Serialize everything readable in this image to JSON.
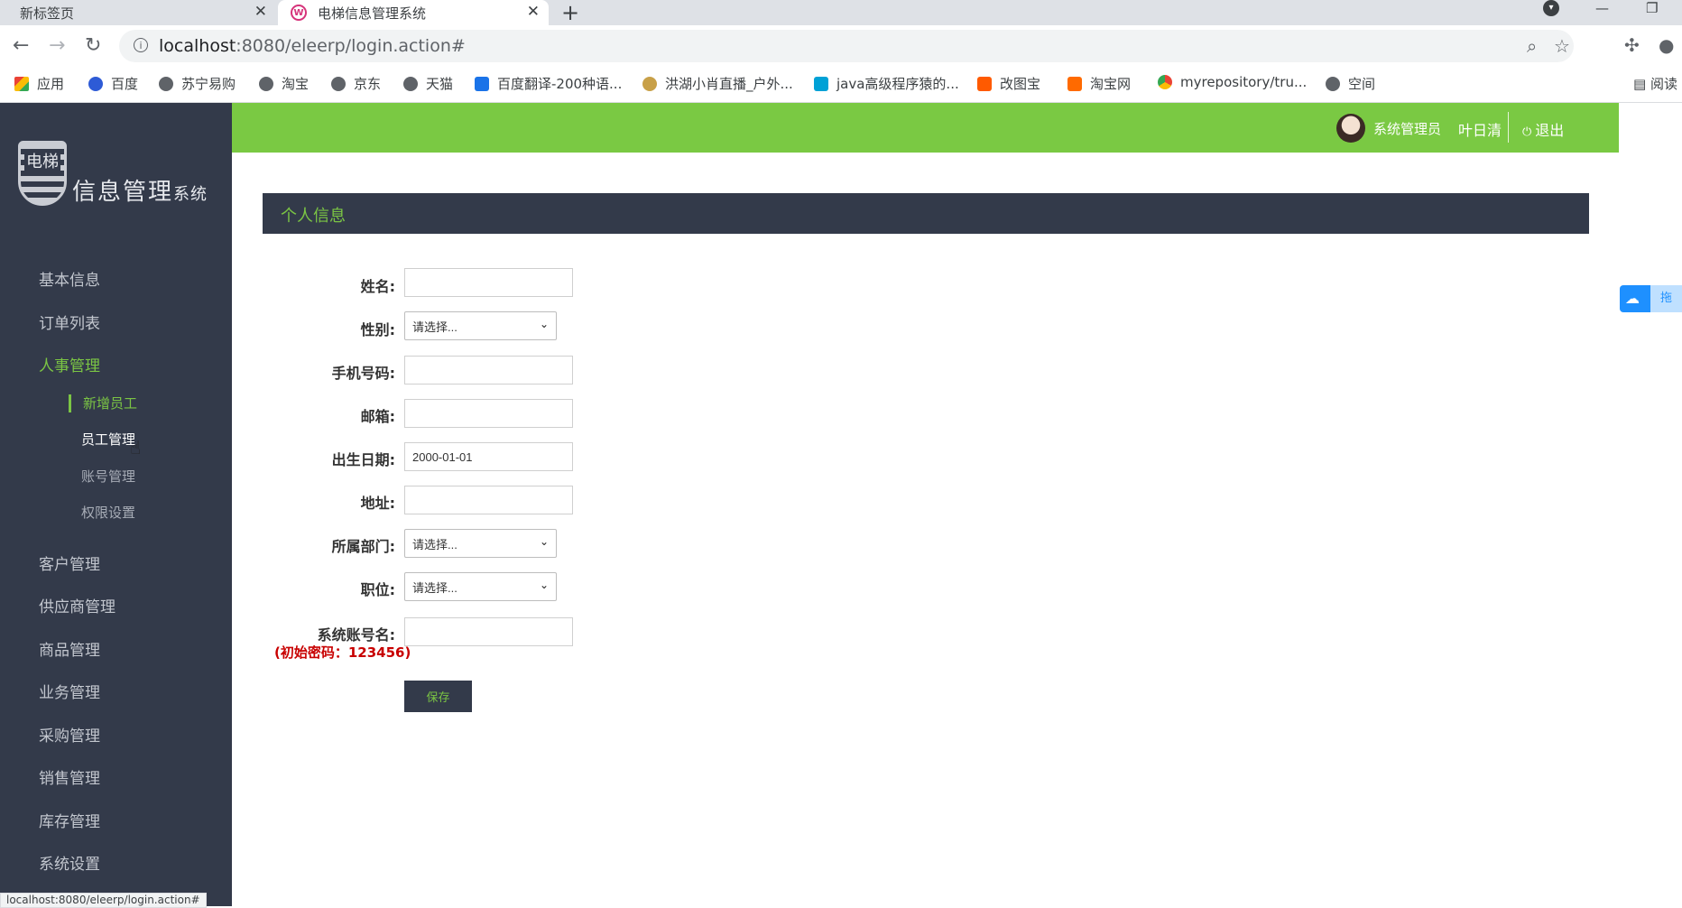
{
  "browser": {
    "tabs": [
      {
        "title": "新标签页",
        "active": false
      },
      {
        "title": "电梯信息管理系统",
        "active": true
      }
    ],
    "url_host": "localhost",
    "url_path": ":8080/eleerp/login.action#",
    "bookmarks": [
      {
        "label": "应用",
        "icon": "apps-grid-icon"
      },
      {
        "label": "百度",
        "icon": "baidu-paw-icon"
      },
      {
        "label": "苏宁易购",
        "icon": "globe-icon"
      },
      {
        "label": "淘宝",
        "icon": "globe-icon"
      },
      {
        "label": "京东",
        "icon": "globe-icon"
      },
      {
        "label": "天猫",
        "icon": "globe-icon"
      },
      {
        "label": "百度翻译-200种语...",
        "icon": "translate-icon"
      },
      {
        "label": "洪湖小肖直播_户外...",
        "icon": "feather-icon"
      },
      {
        "label": "java高级程序猿的...",
        "icon": "tv-icon"
      },
      {
        "label": "改图宝",
        "icon": "orange-square-icon"
      },
      {
        "label": "淘宝网",
        "icon": "taobao-icon"
      },
      {
        "label": "myrepository/tru...",
        "icon": "chrome-icon"
      },
      {
        "label": "空间",
        "icon": "globe-icon"
      }
    ],
    "reading_list": "阅读",
    "status_url": "localhost:8080/eleerp/login.action#"
  },
  "app": {
    "logo_text": "信息管理",
    "logo_text_small": "系统",
    "logo_shield_char": "电梯",
    "menu": [
      {
        "label": "基本信息"
      },
      {
        "label": "订单列表"
      },
      {
        "label": "人事管理",
        "active": true
      },
      {
        "label": "客户管理"
      },
      {
        "label": "供应商管理"
      },
      {
        "label": "商品管理"
      },
      {
        "label": "业务管理"
      },
      {
        "label": "采购管理"
      },
      {
        "label": "销售管理"
      },
      {
        "label": "库存管理"
      },
      {
        "label": "系统设置"
      }
    ],
    "submenu": [
      {
        "label": "新增员工",
        "current": true
      },
      {
        "label": "员工管理"
      },
      {
        "label": "账号管理"
      },
      {
        "label": "权限设置"
      }
    ],
    "topbar": {
      "role": "系统管理员",
      "username": "叶日清",
      "logout": "退出"
    },
    "panel_title": "个人信息",
    "form": {
      "name_label": "姓名:",
      "name_value": "",
      "gender_label": "性别:",
      "gender_selected": "请选择...",
      "phone_label": "手机号码:",
      "phone_value": "",
      "email_label": "邮箱:",
      "email_value": "",
      "birth_label": "出生日期:",
      "birth_value": "2000-01-01",
      "address_label": "地址:",
      "address_value": "",
      "dept_label": "所属部门:",
      "dept_selected": "请选择...",
      "position_label": "职位:",
      "position_selected": "请选择...",
      "account_label": "系统账号名:",
      "account_value": "",
      "password_note": "(初始密码：123456)",
      "save_label": "保存"
    },
    "floating_widget_label": "拖"
  },
  "colors": {
    "sidebar_bg": "#333a4a",
    "accent_green": "#7ac943",
    "warning_red": "#c80000"
  }
}
